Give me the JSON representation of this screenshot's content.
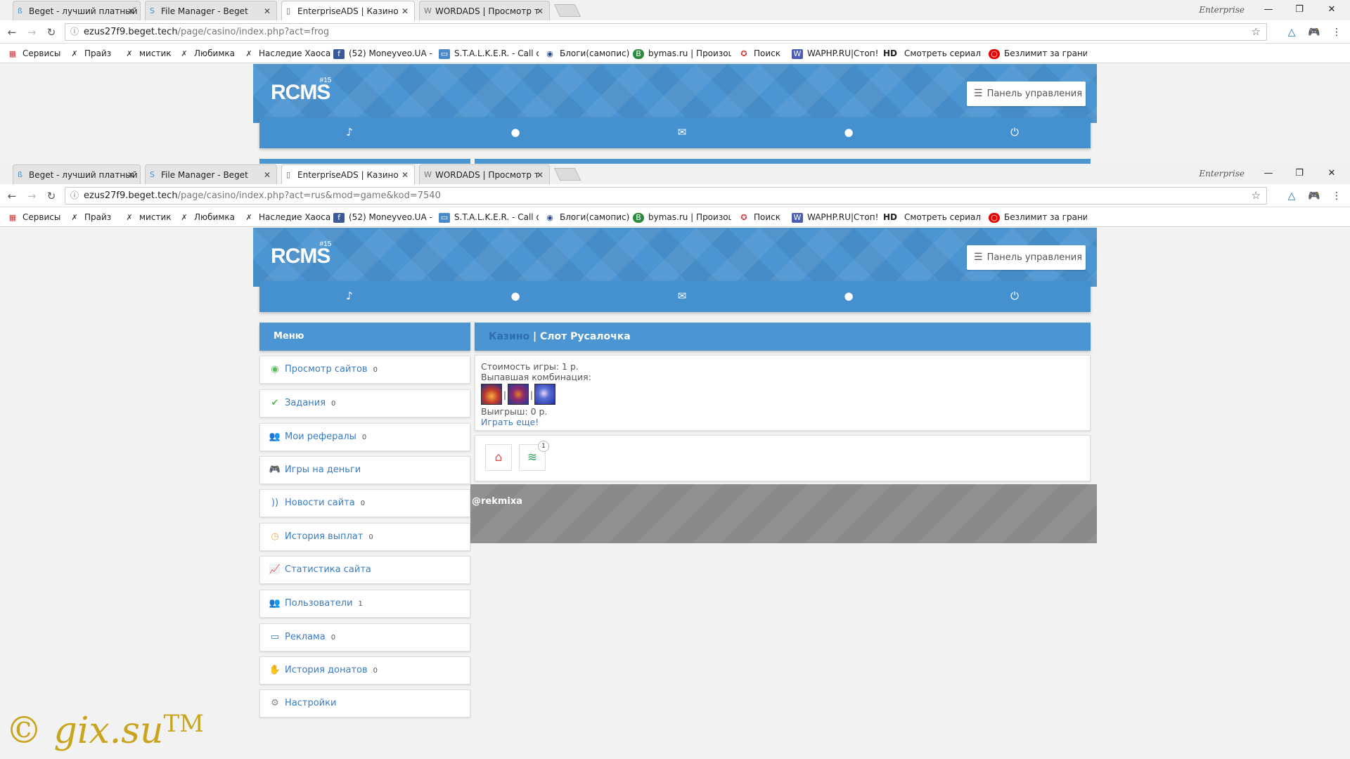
{
  "browser": {
    "tabs": [
      {
        "title": "Beget - лучший платный",
        "icon": "beget-icon"
      },
      {
        "title": "File Manager - Beget",
        "icon": "beget-s-icon"
      },
      {
        "title": "EnterpriseADS | Казино",
        "icon": "page-icon"
      },
      {
        "title": "WORDADS | Просмотр т",
        "icon": "w-icon"
      }
    ],
    "profile_name": "Enterprise",
    "url_top": {
      "host": "ezus27f9.beget.tech",
      "path": "/page/casino/index.php?act=frog"
    },
    "url_bottom": {
      "host": "ezus27f9.beget.tech",
      "path": "/page/casino/index.php?act=rus&mod=game&kod=7540"
    },
    "bookmarks": [
      {
        "label": "Сервисы",
        "icon": "apps-grid-icon"
      },
      {
        "label": "Прайз",
        "icon": "stalker-icon"
      },
      {
        "label": "мистик",
        "icon": "stalker-icon"
      },
      {
        "label": "Любимка",
        "icon": "stalker-icon"
      },
      {
        "label": "Наследие Хаоса",
        "icon": "stalker-icon"
      },
      {
        "label": "(52) Moneyveo.UA -",
        "icon": "facebook-icon"
      },
      {
        "label": "S.T.A.L.K.E.R. - Call of",
        "icon": "chat-icon"
      },
      {
        "label": "Блоги(самопис)",
        "icon": "globe-icon"
      },
      {
        "label": "bymas.ru | Произош",
        "icon": "b-icon"
      },
      {
        "label": "Поиск",
        "icon": "star-badge-icon"
      },
      {
        "label": "WAPHP.RU|Стоп!",
        "icon": "w-icon"
      },
      {
        "label": "Смотреть сериал Г",
        "icon": "hd-icon",
        "prefix": "HD"
      },
      {
        "label": "Безлимит за грани",
        "icon": "vodafone-icon"
      }
    ]
  },
  "site": {
    "logo": "RCMS",
    "logo_version": "#15",
    "control_panel": "Панель управления",
    "menu_title": "Меню",
    "menu": [
      {
        "label": "Просмотр сайтов",
        "count": "0",
        "icon": "eye-icon",
        "color": "#5cb85c"
      },
      {
        "label": "Задания",
        "count": "0",
        "icon": "check-icon",
        "color": "#5cb85c"
      },
      {
        "label": "Мои рефералы",
        "count": "0",
        "icon": "users-icon",
        "color": "#3a7bbf"
      },
      {
        "label": "Игры на деньги",
        "count": "",
        "icon": "gamepad-icon",
        "color": "#3a7bbf"
      },
      {
        "label": "Новости сайта",
        "count": "0",
        "icon": "rss-icon",
        "color": "#3a7bbf"
      },
      {
        "label": "История выплат",
        "count": "0",
        "icon": "history-icon",
        "color": "#f0ad4e"
      },
      {
        "label": "Статистика сайта",
        "count": "",
        "icon": "chart-icon",
        "color": "#d9534f"
      },
      {
        "label": "Пользователи",
        "count": "1",
        "icon": "people-icon",
        "color": "#888888"
      },
      {
        "label": "Реклама",
        "count": "0",
        "icon": "monitor-icon",
        "color": "#3a7bbf"
      },
      {
        "label": "История донатов",
        "count": "0",
        "icon": "hand-coin-icon",
        "color": "#f0ad4e"
      },
      {
        "label": "Настройки",
        "count": "",
        "icon": "gear-icon",
        "color": "#888888"
      }
    ],
    "breadcrumb_link": "Казино",
    "page_title": "| Слот Русалочка",
    "game": {
      "cost": "Стоимость игры: 1 р.",
      "combo_label": "Выпавшая комбинация:",
      "win": "Выигрыш: 0 р.",
      "play_again": "Играть еще!"
    },
    "tools_badge": "1",
    "footer_text": "@rekmixa",
    "watermark": "© gix.su",
    "watermark_tm": "TM"
  }
}
